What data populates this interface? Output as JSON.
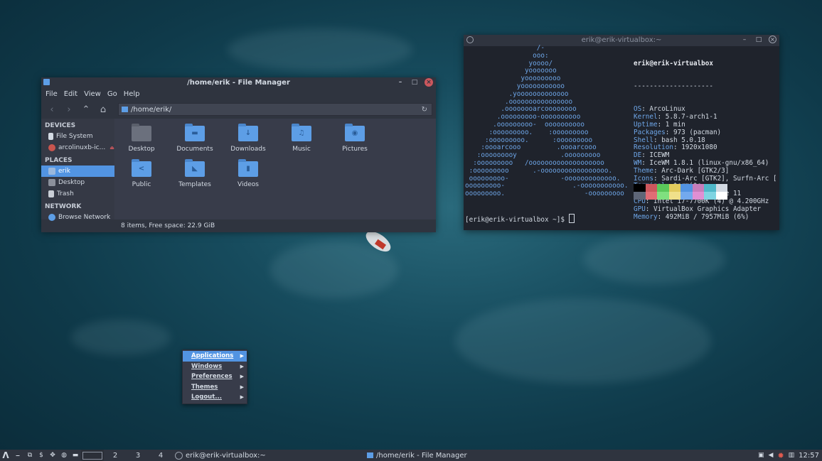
{
  "file_manager": {
    "title": "/home/erik - File Manager",
    "menu": [
      "File",
      "Edit",
      "View",
      "Go",
      "Help"
    ],
    "path": "/home/erik/",
    "sidebar": {
      "devices_header": "DEVICES",
      "devices": [
        "File System",
        "arcolinuxb-ic..."
      ],
      "places_header": "PLACES",
      "places": [
        "erik",
        "Desktop",
        "Trash"
      ],
      "network_header": "NETWORK",
      "network": [
        "Browse Network"
      ]
    },
    "items": [
      {
        "label": "Desktop",
        "icon": "desktop-folder-icon"
      },
      {
        "label": "Documents",
        "icon": "documents-folder-icon"
      },
      {
        "label": "Downloads",
        "icon": "downloads-folder-icon"
      },
      {
        "label": "Music",
        "icon": "music-folder-icon"
      },
      {
        "label": "Pictures",
        "icon": "pictures-folder-icon"
      },
      {
        "label": "Public",
        "icon": "public-folder-icon"
      },
      {
        "label": "Templates",
        "icon": "templates-folder-icon"
      },
      {
        "label": "Videos",
        "icon": "videos-folder-icon"
      }
    ],
    "status": "8 items, Free space: 22.9 GiB"
  },
  "terminal": {
    "title": "erik@erik-virtualbox:~",
    "user_host": "erik@erik-virtualbox",
    "separator": "--------------------",
    "info": [
      {
        "key": "OS",
        "value": "ArcoLinux"
      },
      {
        "key": "Kernel",
        "value": "5.8.7-arch1-1"
      },
      {
        "key": "Uptime",
        "value": "1 min"
      },
      {
        "key": "Packages",
        "value": "973 (pacman)"
      },
      {
        "key": "Shell",
        "value": "bash 5.0.18"
      },
      {
        "key": "Resolution",
        "value": "1920x1080"
      },
      {
        "key": "DE",
        "value": "ICEWM"
      },
      {
        "key": "WM",
        "value": "IceWM 1.8.1 (linux-gnu/x86_64)"
      },
      {
        "key": "Theme",
        "value": "Arc-Dark [GTK2/3]"
      },
      {
        "key": "Icons",
        "value": "Sardi-Arc [GTK2], Surfn-Arc ["
      },
      {
        "key": "Terminal",
        "value": "termite"
      },
      {
        "key": "Terminal Font",
        "value": "Monospace 11"
      },
      {
        "key": "CPU",
        "value": "Intel i7-7700K (4) @ 4.200GHz"
      },
      {
        "key": "GPU",
        "value": "VirtualBox Graphics Adapter"
      },
      {
        "key": "Memory",
        "value": "492MiB / 7957MiB (6%)"
      }
    ],
    "ascii_art": "                  /-\n                 ooo:\n                yoooo/\n               yooooooo\n              yooooooooo\n             yooooooooooo\n           .yooooooooooooo\n          .oooooooooooooooo\n         .oooooooarcoooooooo\n        .ooooooooo-oooooooooo\n       .ooooooooo-  oooooooooo\n      :ooooooooo.    :ooooooooo\n     :ooooooooo.      :ooooooooo\n    :oooarcooo         .oooarcooo\n   :ooooooooy           .ooooooooo\n  :ooooooooo   /ooooooooooooooooooo\n :ooooooooo      .-ooooooooooooooooo.\n ooooooooo-             -ooooooooooooo.\nooooooooo-                 .-ooooooooooo.\nooooooooo.                    -ooooooooo",
    "palette": [
      "#000000",
      "#cc575d",
      "#5ac85a",
      "#e2cb5d",
      "#5294e2",
      "#c77dbb",
      "#4fb8c9",
      "#d3dae3",
      "#5e6677",
      "#e06c75",
      "#7fe07f",
      "#f0e08a",
      "#73a9ee",
      "#e08fd3",
      "#7fd4e2",
      "#ffffff"
    ],
    "prompt": "[erik@erik-virtualbox ~]$ "
  },
  "root_menu": {
    "items": [
      "Applications",
      "Windows",
      "Preferences",
      "Themes",
      "Logout..."
    ]
  },
  "taskbar": {
    "workspaces": [
      "1",
      "2",
      "3",
      "4"
    ],
    "tasks": [
      "erik@erik-virtualbox:~",
      "/home/erik - File Manager"
    ],
    "clock": "12:57"
  }
}
